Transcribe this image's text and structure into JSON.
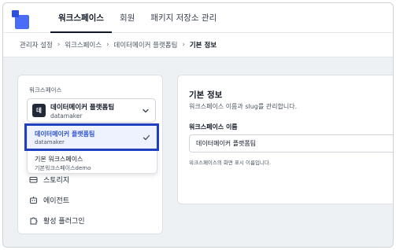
{
  "nav": {
    "tabs": [
      {
        "label": "워크스페이스",
        "active": true
      },
      {
        "label": "회원",
        "active": false
      },
      {
        "label": "패키지 저장소 관리",
        "active": false
      }
    ]
  },
  "breadcrumb": [
    "관리자 설정",
    "워크스페이스",
    "데이터메이커 플랫폼팀",
    "기본 정보"
  ],
  "sidebar": {
    "section_label": "워크스페이스",
    "selected_workspace": {
      "badge": "데",
      "name": "데이터메이커 플랫폼팀",
      "slug": "datamaker"
    },
    "menu": [
      {
        "label": "스토리지",
        "icon": "storage-icon"
      },
      {
        "label": "에이전트",
        "icon": "robot-icon"
      },
      {
        "label": "활성 플러그인",
        "icon": "puzzle-icon"
      }
    ]
  },
  "dropdown": {
    "options": [
      {
        "name": "데이터메이커 플랫폼팀",
        "slug": "datamaker",
        "selected": true
      },
      {
        "name": "기본 워크스페이스",
        "slug": "기본워크스페이스demo",
        "selected": false
      }
    ]
  },
  "panel": {
    "title": "기본 정보",
    "description": "워크스페이스 이름과 slug를 관리합니다.",
    "field_label": "워크스페이스 이름",
    "field_value": "데이터메이커 플랫폼팀",
    "field_help": "워크스페이스의 화면 표시 이름입니다."
  },
  "colors": {
    "accent": "#2f55d4",
    "highlight_border": "#1f3fbf",
    "logo": "#4a6cf7"
  }
}
